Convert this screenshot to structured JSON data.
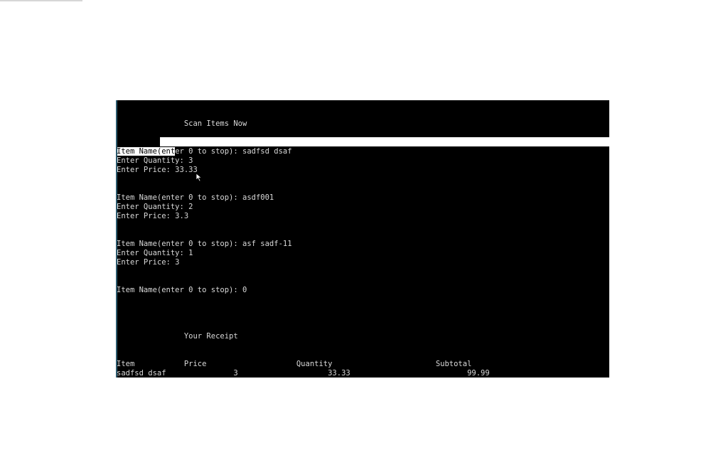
{
  "console": {
    "header": "               Scan Items Now",
    "entries": [
      {
        "name_prompt_sel": "Item Name(ent",
        "name_prompt_rest": "er 0 to stop): sadfsd dsaf",
        "qty": "Enter Quantity: 3",
        "price": "Enter Price: 33.33"
      },
      {
        "name": "Item Name(enter 0 to stop): asdf001",
        "qty": "Enter Quantity: 2",
        "price": "Enter Price: 3.3"
      },
      {
        "name": "Item Name(enter 0 to stop): asf sadf-11",
        "qty": "Enter Quantity: 1",
        "price": "Enter Price: 3"
      }
    ],
    "stop_line": "Item Name(enter 0 to stop): 0",
    "receipt_title": "               Your Receipt",
    "receipt_header": "Item           Price                    Quantity                       Subtotal",
    "receipt_row": "sadfsd dsaf               3                    33.33                          99.99"
  }
}
